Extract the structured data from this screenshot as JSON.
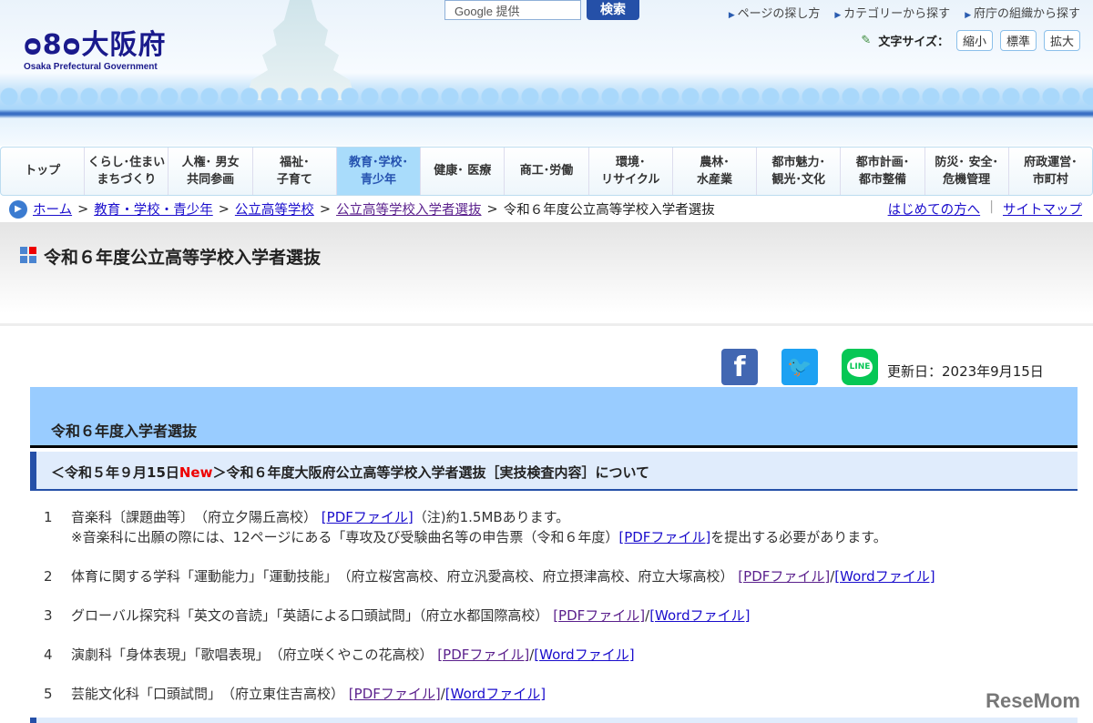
{
  "header": {
    "logo_text": "大阪府",
    "logo_sub": "Osaka Prefectural Government",
    "search_placeholder": "Google 提供",
    "search_button": "検索",
    "top_links": [
      "ページの探し方",
      "カテゴリーから探す",
      "府庁の組織から探す"
    ],
    "font_size_label": "文字サイズ：",
    "font_size_buttons": [
      "縮小",
      "標準",
      "拡大"
    ]
  },
  "nav": [
    "トップ",
    "くらし･住まい\nまちづくり",
    "人権･ 男女\n共同参画",
    "福祉･\n子育て",
    "教育･学校･\n青少年",
    "健康･ 医療",
    "商工･労働",
    "環境･\nリサイクル",
    "農林･\n水産業",
    "都市魅力･\n観光･文化",
    "都市計画･\n都市整備",
    "防災･ 安全･\n危機管理",
    "府政運営･\n市町村"
  ],
  "breadcrumb": {
    "items": [
      "ホーム",
      "教育・学校・青少年",
      "公立高等学校",
      "公立高等学校入学者選抜"
    ],
    "current": "令和６年度公立高等学校入学者選抜",
    "sep": ">"
  },
  "util": [
    "はじめての方へ",
    "サイトマップ"
  ],
  "page_title": "令和６年度公立高等学校入学者選抜",
  "social": {
    "updated": "更新日：2023年9月15日",
    "line": "LINE"
  },
  "section": {
    "title": "令和６年度入学者選抜",
    "sub_pre": "＜令和５年９月15日",
    "sub_new": "New",
    "sub_post": "＞令和６年度大阪府公立高等学校入学者選抜［実技検査内容］について"
  },
  "items": [
    {
      "num": "1",
      "text": "音楽科〔課題曲等〕　（府立夕陽丘高校）",
      "pdf": "[PDFファイル]",
      "tail": "（注)約1.5MBあります。",
      "note_pre": "※音楽科に出願の際には、12ページにある「専攻及び受験曲名等の申告票（令和６年度）",
      "note_link": "[PDFファイル]",
      "note_post": "を提出する必要があります。"
    },
    {
      "num": "2",
      "text": "体育に関する学科「運動能力」「運動技能」　（府立桜宮高校、府立汎愛高校、府立摂津高校、府立大塚高校）",
      "pdf": "[PDFファイル]",
      "word": "[Wordファイル]"
    },
    {
      "num": "3",
      "text": "グローバル探究科「英文の音読」「英語による口頭試問」（府立水都国際高校）",
      "pdf": "[PDFファイル]",
      "word": "[Wordファイル]"
    },
    {
      "num": "4",
      "text": "演劇科「身体表現」「歌唱表現」　（府立咲くやこの花高校）",
      "pdf": "[PDFファイル]",
      "word": "[Wordファイル]"
    },
    {
      "num": "5",
      "text": "芸能文化科「口頭試問」　（府立東住吉高校）",
      "pdf": "[PDFファイル]",
      "word": "[Wordファイル]"
    }
  ],
  "slash": "/",
  "watermark": "ReseMom"
}
